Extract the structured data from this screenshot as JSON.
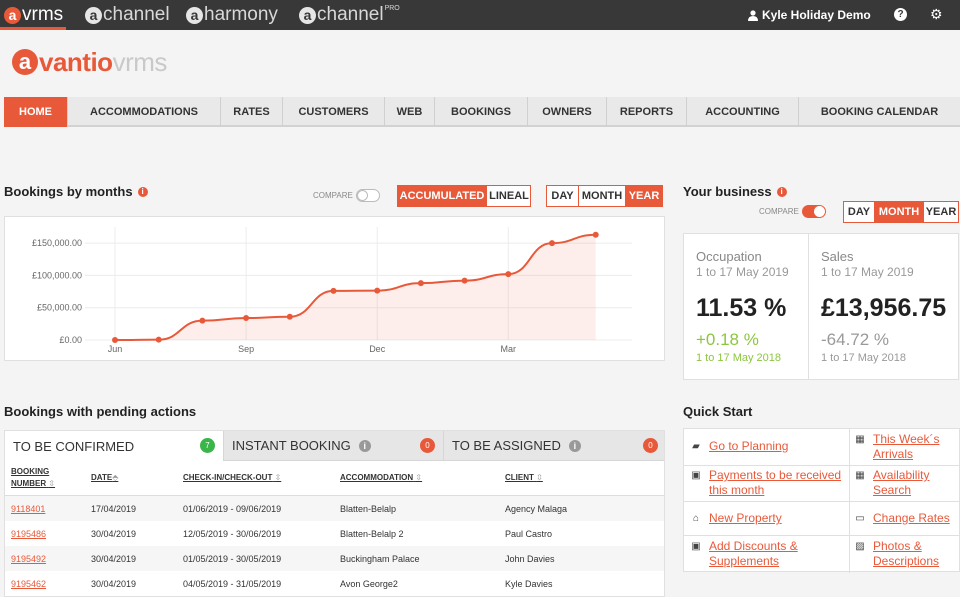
{
  "topbar": {
    "apps": [
      {
        "letter": "a",
        "name": "vrms",
        "sup": ""
      },
      {
        "letter": "a",
        "name": "channel",
        "sup": ""
      },
      {
        "letter": "a",
        "name": "harmony",
        "sup": ""
      },
      {
        "letter": "a",
        "name": "channel",
        "sup": "PRO"
      }
    ],
    "user_name": "Kyle Holiday Demo",
    "help_glyph": "?",
    "gear_glyph": "⚙"
  },
  "logo": {
    "letter": "a",
    "word1": "vantio",
    "word2": "vrms"
  },
  "nav": [
    "HOME",
    "ACCOMMODATIONS",
    "RATES",
    "CUSTOMERS",
    "WEB",
    "BOOKINGS",
    "OWNERS",
    "REPORTS",
    "ACCOUNTING",
    "BOOKING CALENDAR"
  ],
  "bookings_chart": {
    "title": "Bookings by months",
    "compare_label": "COMPARE",
    "mode_buttons": [
      "ACCUMULATED",
      "LINEAL"
    ],
    "period_buttons": [
      "DAY",
      "MONTH",
      "YEAR"
    ]
  },
  "chart_data": {
    "type": "area",
    "x_ticks": [
      "Jun",
      "Sep",
      "Dec",
      "Mar"
    ],
    "y_ticks": [
      "£0.00",
      "£50,000.00",
      "£100,000.00",
      "£150,000.00"
    ],
    "ylim": [
      0,
      175000
    ],
    "x": [
      "Jun",
      "Jul",
      "Aug",
      "Sep",
      "Oct",
      "Nov",
      "Dec",
      "Jan",
      "Feb",
      "Mar",
      "Apr",
      "May"
    ],
    "values": [
      0,
      500,
      30000,
      34000,
      36000,
      76000,
      76500,
      88000,
      92000,
      102000,
      150000,
      163000
    ],
    "accent_color": "#e8593a",
    "grid": true
  },
  "business": {
    "title": "Your business",
    "compare_label": "COMPARE",
    "period_buttons": [
      "DAY",
      "MONTH",
      "YEAR"
    ],
    "occupation": {
      "label": "Occupation",
      "period": "1 to 17 May 2019",
      "value": "11.53 %",
      "change": "+0.18 %",
      "prev_period": "1 to 17 May 2018"
    },
    "sales": {
      "label": "Sales",
      "period": "1 to 17 May 2019",
      "value": "£13,956.75",
      "change": "-64.72 %",
      "prev_period": "1 to 17 May 2018"
    }
  },
  "pending": {
    "title": "Bookings with pending actions",
    "tabs": [
      {
        "label": "TO BE CONFIRMED",
        "count": "7"
      },
      {
        "label": "INSTANT BOOKING",
        "count": "0",
        "info_glyph": "i"
      },
      {
        "label": "TO BE ASSIGNED",
        "count": "0",
        "info_glyph": "i"
      }
    ],
    "columns": [
      "BOOKING",
      "NUMBER",
      "DATE",
      "CHECK-IN/CHECK-OUT",
      "ACCOMMODATION",
      "CLIENT"
    ],
    "rows": [
      {
        "number": "9118401",
        "date": "17/04/2019",
        "checkin": "01/06/2019 - 09/06/2019",
        "accommodation": "Blatten-Belalp",
        "client": "Agency Malaga"
      },
      {
        "number": "9195486",
        "date": "30/04/2019",
        "checkin": "12/05/2019 - 30/06/2019",
        "accommodation": "Blatten-Belalp 2",
        "client": "Paul Castro"
      },
      {
        "number": "9195492",
        "date": "30/04/2019",
        "checkin": "01/05/2019 - 30/05/2019",
        "accommodation": "Buckingham Palace",
        "client": "John Davies"
      },
      {
        "number": "9195462",
        "date": "30/04/2019",
        "checkin": "04/05/2019 - 31/05/2019",
        "accommodation": "Avon George2",
        "client": "Kyle Davies"
      }
    ]
  },
  "quick_start": {
    "title": "Quick Start",
    "items": [
      {
        "l1": "Go to Planning",
        "l2": "",
        "icon": "briefcase-icon"
      },
      {
        "l1": "This Week´s",
        "l2": "Arrivals",
        "icon": "calendar-icon"
      },
      {
        "l1": "Payments to be received",
        "l2": "this month",
        "icon": "money-icon"
      },
      {
        "l1": "Availability",
        "l2": "Search",
        "icon": "calendar-icon"
      },
      {
        "l1": "New Property",
        "l2": "",
        "icon": "home-icon"
      },
      {
        "l1": "Change Rates",
        "l2": "",
        "icon": "credit-card-icon"
      },
      {
        "l1": "Add Discounts &",
        "l2": "Supplements",
        "icon": "money-icon"
      },
      {
        "l1": "Photos &",
        "l2": "Descriptions",
        "icon": "picture-icon"
      }
    ]
  }
}
